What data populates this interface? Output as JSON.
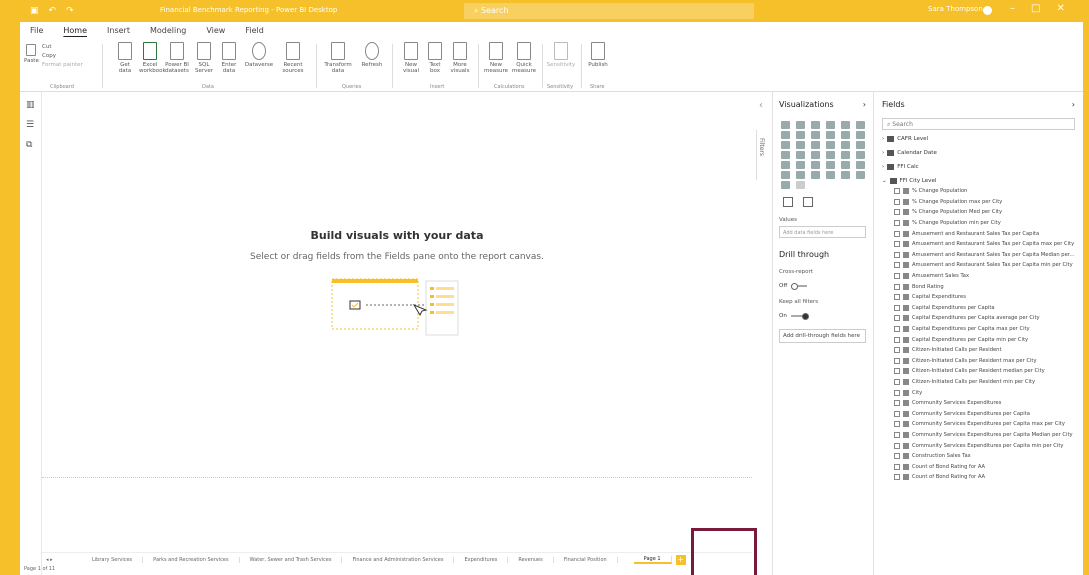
{
  "title_bar": {
    "doc_title": "Financial Benchmark Reporting - Power BI Desktop",
    "search_placeholder": "Search",
    "user_name": "Sara Thompson",
    "window_controls": [
      "–",
      "□",
      "✕"
    ]
  },
  "menu": [
    "File",
    "Home",
    "Insert",
    "Modeling",
    "View",
    "Field"
  ],
  "ribbon": {
    "clipboard": [
      "Cut",
      "Copy",
      "Format painter",
      "Paste"
    ],
    "data_buttons": [
      "Get data",
      "Excel workbook",
      "Power BI datasets",
      "SQL Server",
      "Enter data",
      "Dataverse",
      "Recent sources"
    ],
    "queries": [
      "Transform data",
      "Refresh"
    ],
    "insert": [
      "New visual",
      "Text box",
      "More visuals"
    ],
    "calculations": [
      "New measure",
      "Quick measure"
    ],
    "sensitivity": "Sensitivity",
    "share": "Publish",
    "groups": [
      "Clipboard",
      "Data",
      "Queries",
      "Insert",
      "Calculations",
      "Sensitivity",
      "Share"
    ]
  },
  "canvas": {
    "heading": "Build visuals with your data",
    "subheading": "Select or drag fields from the Fields pane onto the report canvas."
  },
  "filters_label": "Filters",
  "visualizations": {
    "title": "Visualizations",
    "values_label": "Values",
    "values_placeholder": "Add data fields here",
    "drill_through": "Drill through",
    "cross_report": "Cross-report",
    "cross_report_state": "Off",
    "keep_all_filters": "Keep all filters",
    "keep_all_filters_state": "On",
    "add_drill_fields": "Add drill-through fields here"
  },
  "fields": {
    "title": "Fields",
    "search_placeholder": "Search",
    "tables": [
      "CAFR Level",
      "Calendar Date",
      "FFI Calc",
      "FFI City Level"
    ],
    "items": [
      "% Change Population",
      "% Change Population max per City",
      "% Change Population Med per City",
      "% Change Population min per City",
      "Amusement and Restaurant Sales Tax per Capita",
      "Amusement and Restaurant Sales Tax per Capita max per City",
      "Amusement and Restaurant Sales Tax per Capita Median per...",
      "Amusement and Restaurant Sales Tax per Capita min per City",
      "Amusement Sales Tax",
      "Bond Rating",
      "Capital Expenditures",
      "Capital Expenditures per Capita",
      "Capital Expenditures per Capita average per City",
      "Capital Expenditures per Capita max per City",
      "Capital Expenditures per Capita min per City",
      "Citizen-Initiated Calls per Resident",
      "Citizen-Initiated Calls per Resident max per City",
      "Citizen-Initiated Calls per Resident median per City",
      "Citizen-Initiated Calls per Resident min per City",
      "City",
      "Community Services Expenditures",
      "Community Services Expenditures per Capita",
      "Community Services Expenditures per Capita max per City",
      "Community Services Expenditures per Capita Median per City",
      "Community Services Expenditures per Capita min per City",
      "Construction Sales Tax",
      "Count of Bond Rating for AA",
      "Count of Bond Rating for AA"
    ]
  },
  "pages": {
    "tabs": [
      "Library Services",
      "Parks and Recreation Services",
      "Water, Sewer and Trash Services",
      "Finance and Administration Services",
      "Expenditures",
      "Revenues",
      "Financial Position",
      "Page 1"
    ],
    "active": "Page 1",
    "add": "+"
  },
  "status": "Page 1 of 11",
  "colors": {
    "accent": "#f5c02a",
    "highlight_box": "#7a1a3a"
  }
}
